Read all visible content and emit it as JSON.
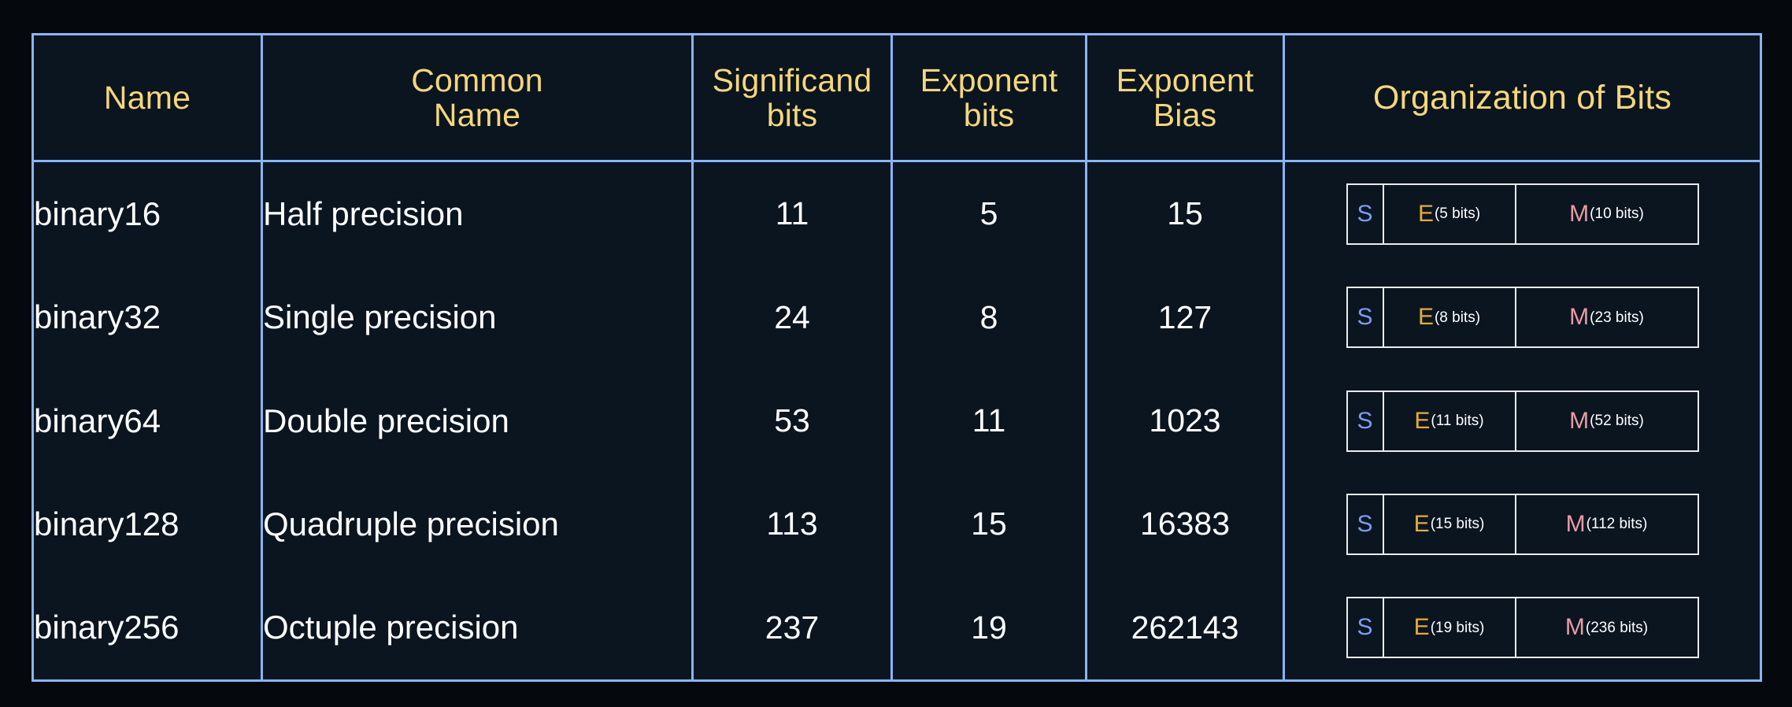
{
  "table": {
    "headers": [
      {
        "label": "Name"
      },
      {
        "label": "Common\nName"
      },
      {
        "label": "Significand\nbits"
      },
      {
        "label": "Exponent\nbits"
      },
      {
        "label": "Exponent\nBias"
      },
      {
        "label": "Organization of Bits"
      }
    ],
    "rows": [
      {
        "name": "binary16",
        "common_name": "Half precision",
        "significand_bits": "11",
        "exponent_bits": "5",
        "exponent_bias": "15",
        "organization": {
          "sign": "S",
          "exponent": "E",
          "exponent_label": "(5 bits)",
          "mantissa": "M",
          "mantissa_label": "(10 bits)"
        }
      },
      {
        "name": "binary32",
        "common_name": "Single precision",
        "significand_bits": "24",
        "exponent_bits": "8",
        "exponent_bias": "127",
        "organization": {
          "sign": "S",
          "exponent": "E",
          "exponent_label": "(8 bits)",
          "mantissa": "M",
          "mantissa_label": "(23 bits)"
        }
      },
      {
        "name": "binary64",
        "common_name": "Double precision",
        "significand_bits": "53",
        "exponent_bits": "11",
        "exponent_bias": "1023",
        "organization": {
          "sign": "S",
          "exponent": "E",
          "exponent_label": "(11 bits)",
          "mantissa": "M",
          "mantissa_label": "(52 bits)"
        }
      },
      {
        "name": "binary128",
        "common_name": "Quadruple precision",
        "significand_bits": "113",
        "exponent_bits": "15",
        "exponent_bias": "16383",
        "organization": {
          "sign": "S",
          "exponent": "E",
          "exponent_label": "(15 bits)",
          "mantissa": "M",
          "mantissa_label": "(112 bits)"
        }
      },
      {
        "name": "binary256",
        "common_name": "Octuple precision",
        "significand_bits": "237",
        "exponent_bits": "19",
        "exponent_bias": "262143",
        "organization": {
          "sign": "S",
          "exponent": "E",
          "exponent_label": "(19 bits)",
          "mantissa": "M",
          "mantissa_label": "(236 bits)"
        }
      }
    ]
  },
  "colors": {
    "page_background": "#05090d",
    "cell_background": "#0a1520",
    "grid_line": "#8ab4f8",
    "header_text": "#f6d67c",
    "body_text": "#ffffff",
    "sign_bit": "#7a9cf0",
    "exponent_bit": "#e8a93a",
    "mantissa_bit": "#eb9aa4",
    "bit_box_border": "#e9ecef"
  }
}
